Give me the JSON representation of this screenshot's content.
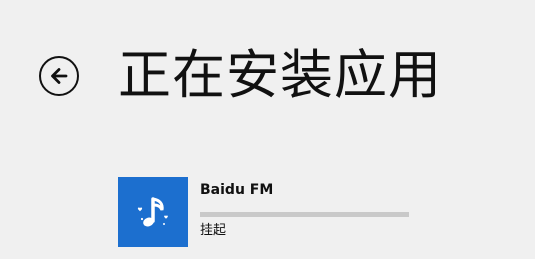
{
  "header": {
    "title": "正在安装应用",
    "back_icon": "arrow-left-circle-icon"
  },
  "install_queue": {
    "items": [
      {
        "name": "Baidu FM",
        "status": "挂起",
        "progress_percent": 0,
        "icon": "music-note-icon",
        "tile_color": "#1c6fcf"
      }
    ]
  },
  "colors": {
    "background": "#f0f0f0",
    "text": "#111111",
    "progress_track": "#c9c9c9"
  }
}
